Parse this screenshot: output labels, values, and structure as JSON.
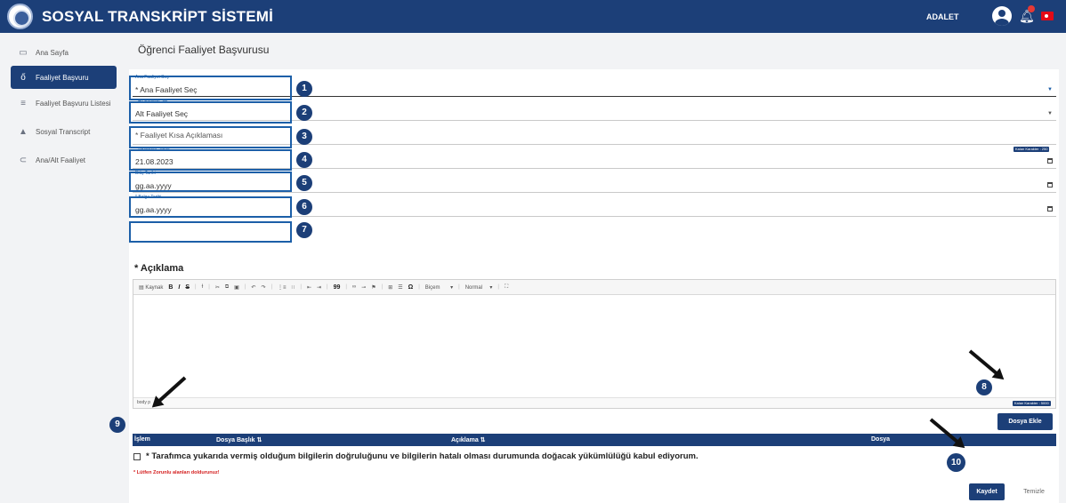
{
  "header": {
    "title": "SOSYAL TRANSKRİPT SİSTEMİ",
    "user": "ADALET",
    "bell_icon": "bell-icon",
    "flag": "turkey-flag"
  },
  "sidebar": {
    "items": [
      {
        "label": "Ana Sayfa",
        "icon": "monitor-icon",
        "active": false
      },
      {
        "label": "Faaliyet Başvuru",
        "icon": "bicycle-icon",
        "active": true
      },
      {
        "label": "Faaliyet Başvuru Listesi",
        "icon": "list-icon",
        "active": false
      },
      {
        "label": "Sosyal Transcript",
        "icon": "graduation-cap-icon",
        "active": false
      },
      {
        "label": "Ana/Alt Faaliyet",
        "icon": "paperclip-icon",
        "active": false
      }
    ]
  },
  "page": {
    "title": "Öğrenci Faaliyet Başvurusu"
  },
  "form": {
    "ana_faaliyet": {
      "small_label": "Ana Faaliyet Seç",
      "value": "* Ana Faaliyet Seç"
    },
    "alt_faaliyet": {
      "small_label": "* Alt Faaliyet Seç",
      "value": "Alt Faaliyet Seç"
    },
    "kisa_aciklama": {
      "placeholder": "* Faaliyet Kısa Açıklaması",
      "counter": "Kalan Karakter : 250"
    },
    "baslangic": {
      "small_label": "* Başlangıç Tarihi",
      "value": "21.08.2023"
    },
    "bitis": {
      "small_label": "Bitiş Tarihi",
      "value": "gg.aa.yyyy"
    },
    "belge": {
      "small_label": "* Belge Tarihi",
      "value": "gg.aa.yyyy"
    },
    "aciklama_label": "* Açıklama",
    "editor": {
      "toolbar": {
        "source": "Kaynak",
        "bold": "B",
        "italic": "I",
        "strike": "S",
        "quote": "99",
        "omega": "Ω",
        "format": "Biçem",
        "size": "Normal"
      },
      "status": "body p",
      "counter": "Kalan Karakter : 5000"
    },
    "add_file_label": "Dosya Ekle",
    "table": {
      "columns": [
        "İşlem",
        "Dosya Başlık ⇅",
        "Açıklama ⇅",
        "Dosya"
      ]
    },
    "consent": "* Tarafımca yukarıda vermiş olduğum bilgilerin doğruluğunu ve bilgilerin hatalı olması durumunda doğacak yükümlülüğü kabul ediyorum.",
    "warning": "* Lütfen Zorunlu alanları doldurunuz!",
    "save_label": "Kaydet",
    "clear_label": "Temizle"
  },
  "annotations": {
    "steps": [
      "1",
      "2",
      "3",
      "4",
      "5",
      "6",
      "7",
      "8",
      "9",
      "10"
    ]
  },
  "colors": {
    "primary": "#1c3f78",
    "accent": "#1c5fa8",
    "warning": "#d42020"
  }
}
